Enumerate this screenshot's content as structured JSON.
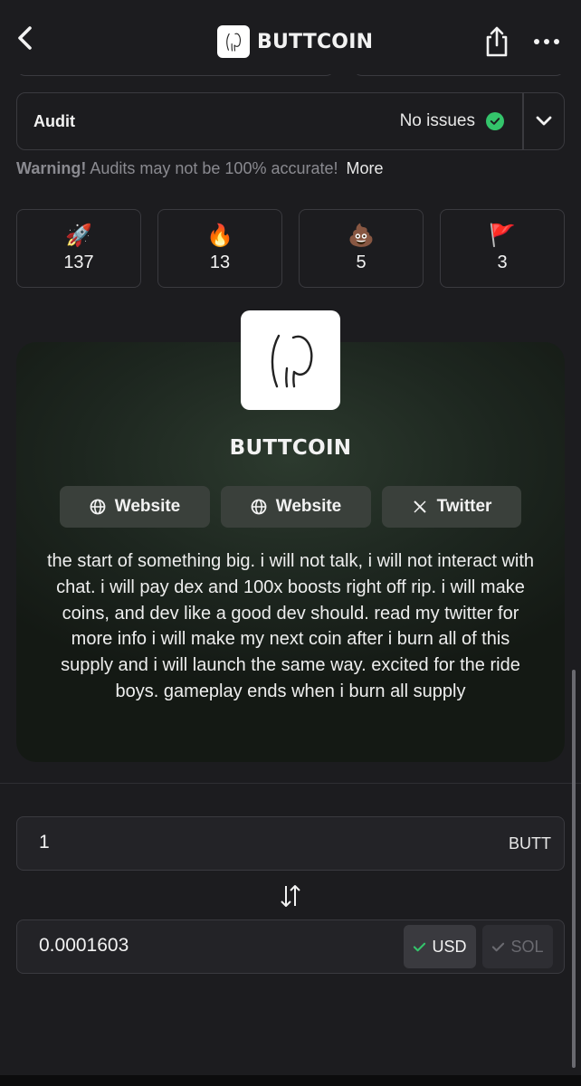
{
  "header": {
    "title": "BUTTCOIN",
    "icons": [
      "chevron-left-icon",
      "share-icon",
      "more-icon"
    ]
  },
  "audit": {
    "label": "Audit",
    "status": "No issues",
    "status_color": "#34c46b"
  },
  "warning": {
    "prefix": "Warning!",
    "text": "Audits may not be 100% accurate!",
    "more": "More"
  },
  "reactions": [
    {
      "emoji": "🚀",
      "icon": "rocket-icon",
      "count": "137"
    },
    {
      "emoji": "🔥",
      "icon": "fire-icon",
      "count": "13"
    },
    {
      "emoji": "💩",
      "icon": "poop-icon",
      "count": "5"
    },
    {
      "emoji": "🚩",
      "icon": "red-flag-icon",
      "count": "3"
    }
  ],
  "token": {
    "name": "BUTTCOIN",
    "links": [
      {
        "label": "Website",
        "icon": "globe-icon"
      },
      {
        "label": "Website",
        "icon": "globe-icon"
      },
      {
        "label": "Twitter",
        "icon": "x-logo-icon"
      }
    ],
    "description": "the start of something big. i will not talk, i will not interact with chat. i will pay dex and 100x boosts right off rip. i will make coins, and dev like a good dev should. read my twitter for more info i will make my next coin after i burn all of this supply and i will launch the same way. excited for the ride boys. gameplay ends when i burn all supply"
  },
  "converter": {
    "token_amount": "1",
    "token_unit": "BUTT",
    "price_value": "0.0001603",
    "currencies": [
      {
        "label": "USD",
        "selected": true
      },
      {
        "label": "SOL",
        "selected": false
      }
    ]
  }
}
